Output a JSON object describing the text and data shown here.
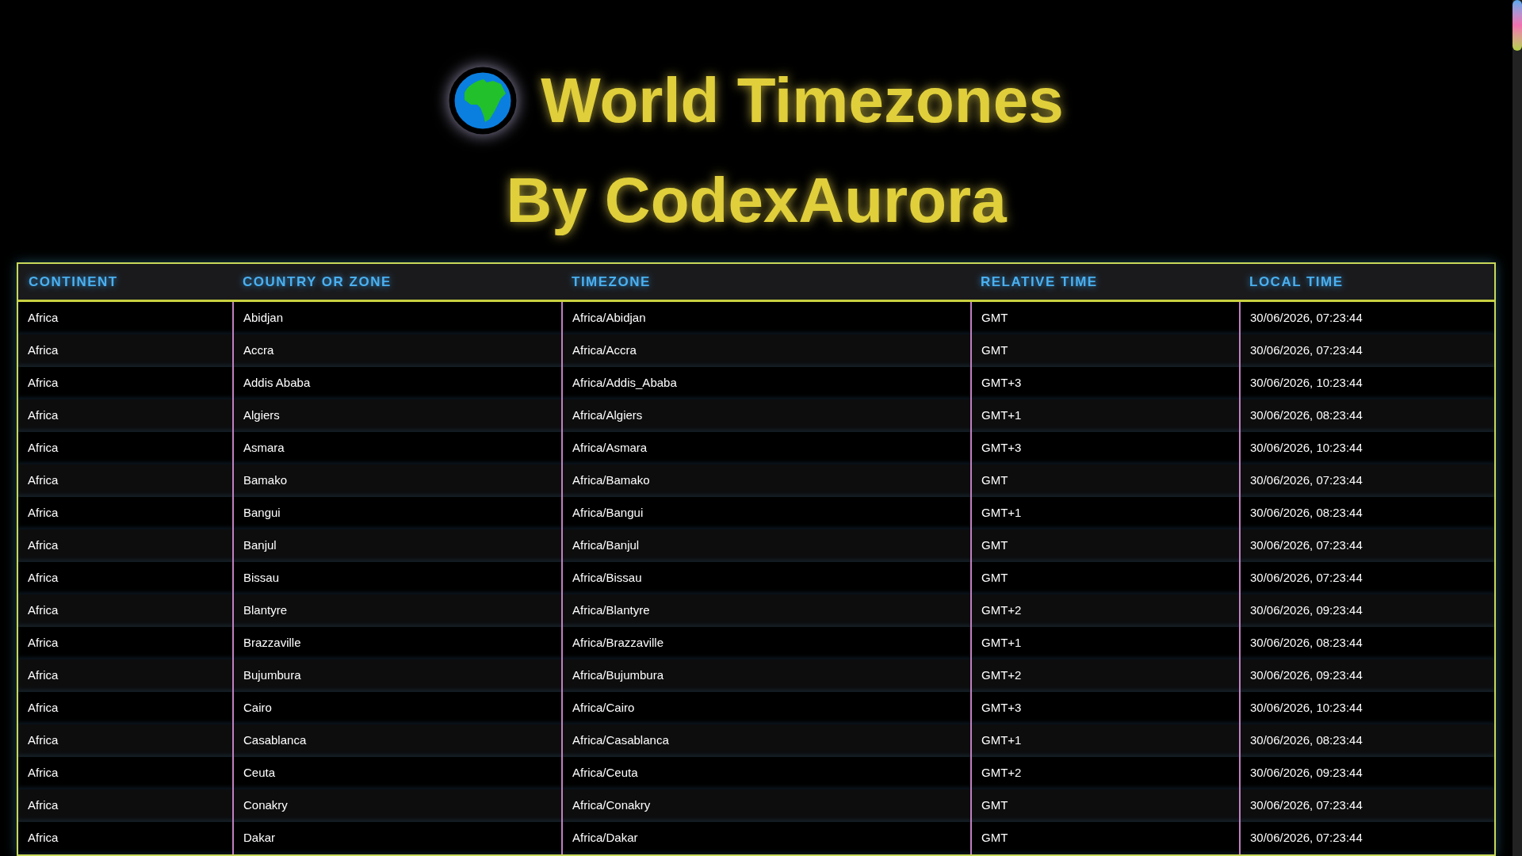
{
  "title": "World Timezones",
  "subtitle": "By CodexAurora",
  "table": {
    "columns": [
      "CONTINENT",
      "COUNTRY OR ZONE",
      "TIMEZONE",
      "RELATIVE TIME",
      "LOCAL TIME"
    ],
    "rows": [
      [
        "Africa",
        "Abidjan",
        "Africa/Abidjan",
        "GMT",
        "30/06/2026, 07:23:44"
      ],
      [
        "Africa",
        "Accra",
        "Africa/Accra",
        "GMT",
        "30/06/2026, 07:23:44"
      ],
      [
        "Africa",
        "Addis Ababa",
        "Africa/Addis_Ababa",
        "GMT+3",
        "30/06/2026, 10:23:44"
      ],
      [
        "Africa",
        "Algiers",
        "Africa/Algiers",
        "GMT+1",
        "30/06/2026, 08:23:44"
      ],
      [
        "Africa",
        "Asmara",
        "Africa/Asmara",
        "GMT+3",
        "30/06/2026, 10:23:44"
      ],
      [
        "Africa",
        "Bamako",
        "Africa/Bamako",
        "GMT",
        "30/06/2026, 07:23:44"
      ],
      [
        "Africa",
        "Bangui",
        "Africa/Bangui",
        "GMT+1",
        "30/06/2026, 08:23:44"
      ],
      [
        "Africa",
        "Banjul",
        "Africa/Banjul",
        "GMT",
        "30/06/2026, 07:23:44"
      ],
      [
        "Africa",
        "Bissau",
        "Africa/Bissau",
        "GMT",
        "30/06/2026, 07:23:44"
      ],
      [
        "Africa",
        "Blantyre",
        "Africa/Blantyre",
        "GMT+2",
        "30/06/2026, 09:23:44"
      ],
      [
        "Africa",
        "Brazzaville",
        "Africa/Brazzaville",
        "GMT+1",
        "30/06/2026, 08:23:44"
      ],
      [
        "Africa",
        "Bujumbura",
        "Africa/Bujumbura",
        "GMT+2",
        "30/06/2026, 09:23:44"
      ],
      [
        "Africa",
        "Cairo",
        "Africa/Cairo",
        "GMT+3",
        "30/06/2026, 10:23:44"
      ],
      [
        "Africa",
        "Casablanca",
        "Africa/Casablanca",
        "GMT+1",
        "30/06/2026, 08:23:44"
      ],
      [
        "Africa",
        "Ceuta",
        "Africa/Ceuta",
        "GMT+2",
        "30/06/2026, 09:23:44"
      ],
      [
        "Africa",
        "Conakry",
        "Africa/Conakry",
        "GMT",
        "30/06/2026, 07:23:44"
      ],
      [
        "Africa",
        "Dakar",
        "Africa/Dakar",
        "GMT",
        "30/06/2026, 07:23:44"
      ]
    ]
  }
}
